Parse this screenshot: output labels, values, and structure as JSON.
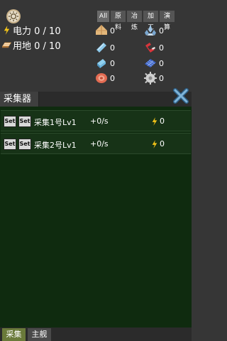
{
  "stats": {
    "power_label": "电力 0 / 10",
    "land_label": "用地 0 / 10",
    "power_icon": "lightning-icon",
    "land_icon": "land-icon"
  },
  "filters": [
    "All",
    "原料",
    "冶炼",
    "加工",
    "演算"
  ],
  "resources": [
    {
      "icon": "wood-icon",
      "value": "0"
    },
    {
      "icon": "crystal-icon",
      "value": "0"
    },
    {
      "icon": "glass-icon",
      "value": "0"
    },
    {
      "icon": "magnet-icon",
      "value": "0"
    },
    {
      "icon": "battery-icon",
      "value": "0"
    },
    {
      "icon": "solar-panel-icon",
      "value": "0"
    },
    {
      "icon": "coil-icon",
      "value": "0"
    },
    {
      "icon": "cog-icon",
      "value": "0"
    }
  ],
  "panel": {
    "title": "采集器",
    "close_icon": "close-icon"
  },
  "collectors": [
    {
      "set1": "Set",
      "set2": "Set",
      "name": "采集1号Lv1",
      "rate": "+0/s",
      "power": "0"
    },
    {
      "set1": "Set",
      "set2": "Set",
      "name": "采集2号Lv1",
      "rate": "+0/s",
      "power": "0"
    }
  ],
  "tabs": [
    {
      "label": "采集",
      "active": true
    },
    {
      "label": "主舰",
      "active": false
    }
  ],
  "colors": {
    "background": "#363636",
    "panel_green": "#0f2b0f",
    "row_green": "#173317",
    "accent_yellow": "#f5c518"
  }
}
